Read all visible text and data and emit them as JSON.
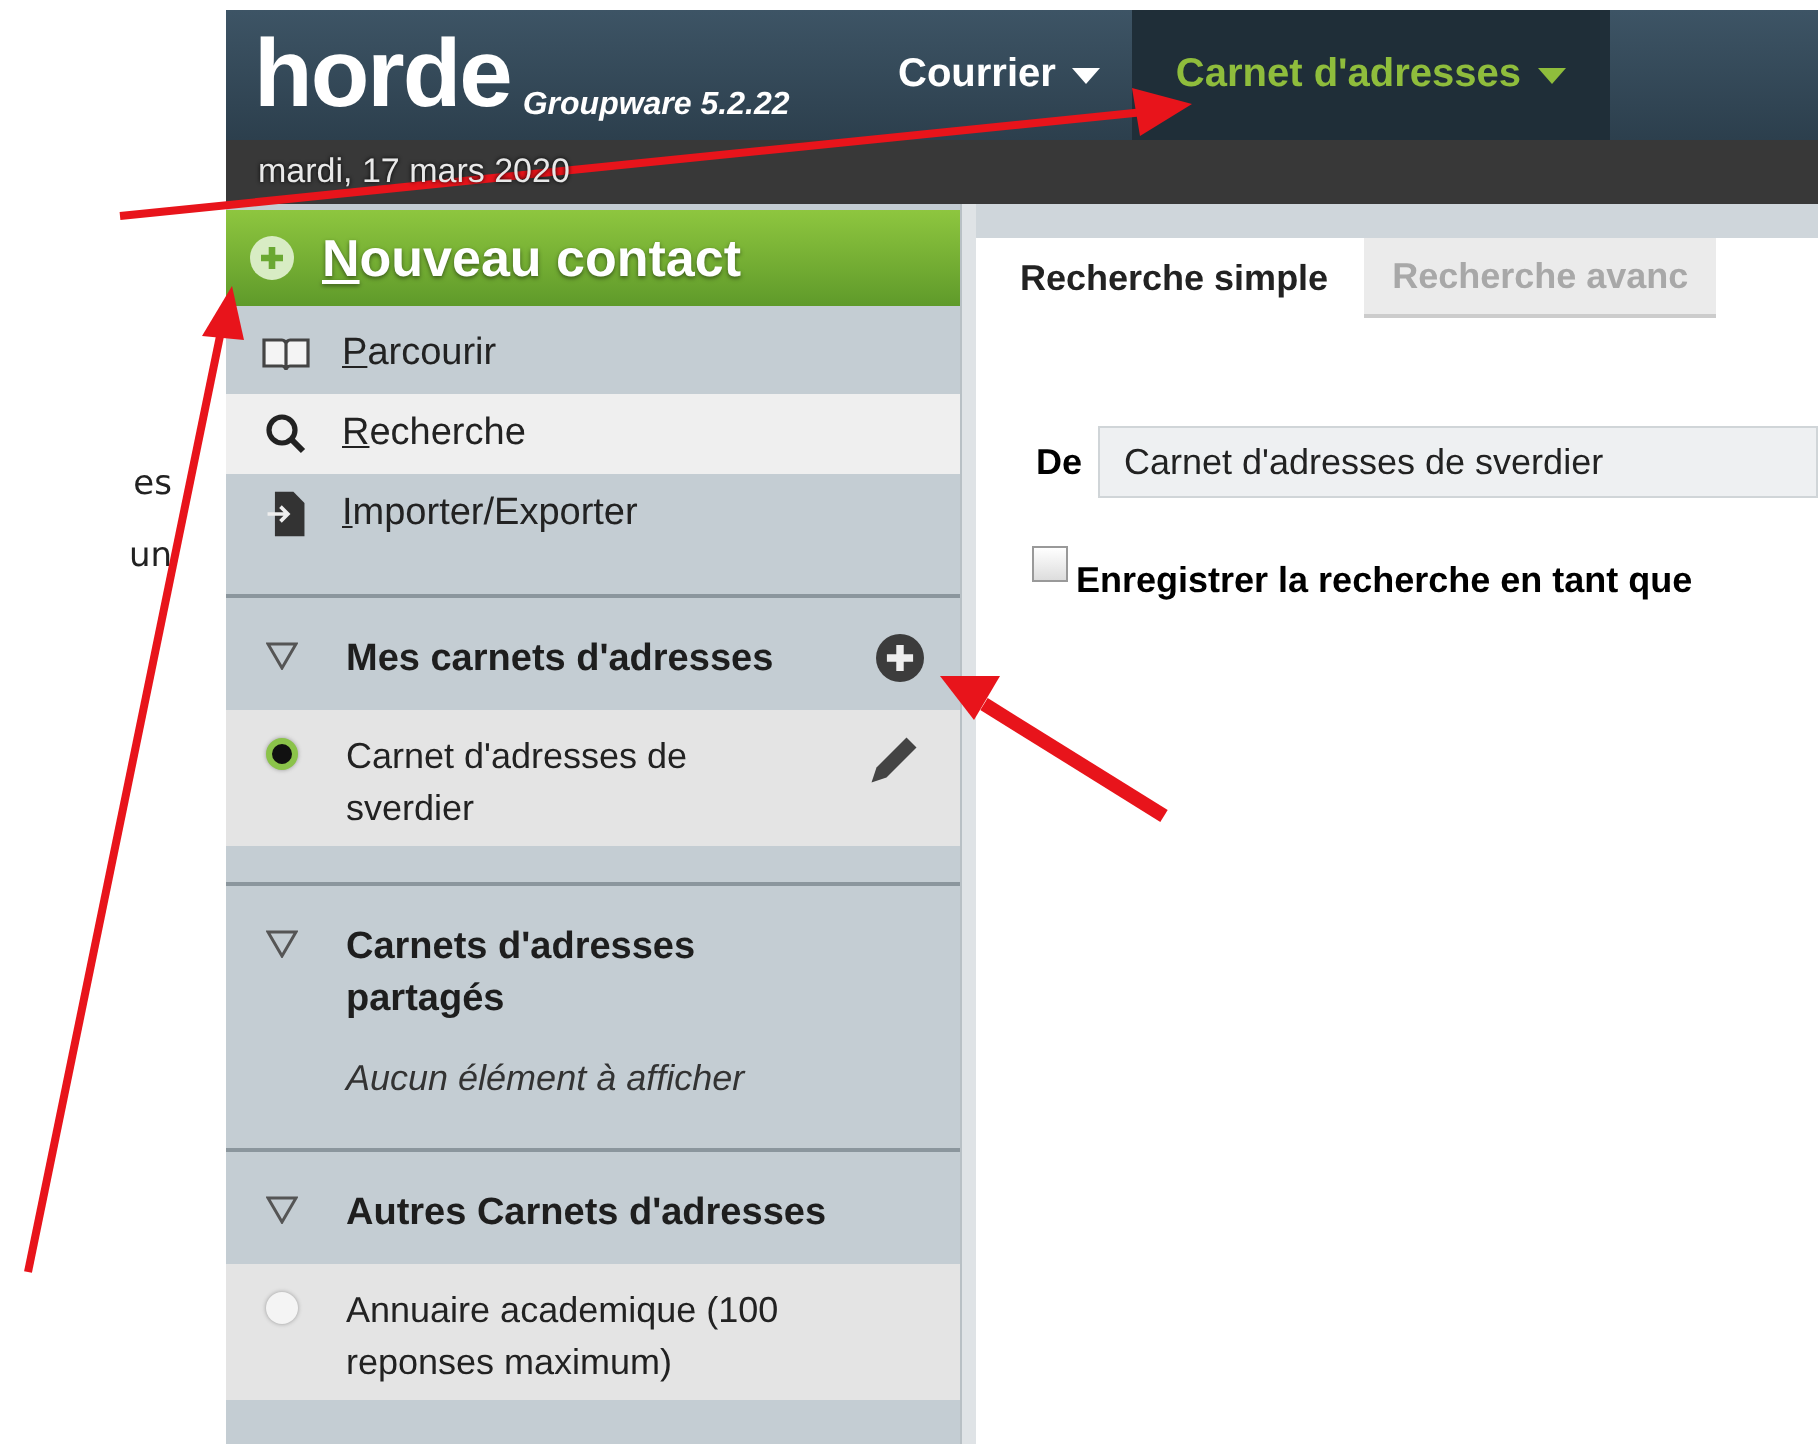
{
  "margin_text": [
    "es",
    "un"
  ],
  "header": {
    "logo": "horde",
    "product": "Groupware 5.2.22",
    "nav": [
      {
        "label": "Courrier",
        "selected": false
      },
      {
        "label": "Carnet d'adresses",
        "selected": true
      }
    ]
  },
  "date": "mardi, 17 mars 2020",
  "sidebar": {
    "new_contact": "Nouveau contact",
    "items": [
      {
        "label": "Parcourir",
        "kind": "browse",
        "selected": false
      },
      {
        "label": "Recherche",
        "kind": "search",
        "selected": true
      },
      {
        "label": "Importer/Exporter",
        "kind": "import",
        "selected": false
      }
    ],
    "sections": [
      {
        "title": "Mes carnets d'adresses",
        "expanded": true,
        "addable": true,
        "books": [
          {
            "name": "Carnet d'adresses de sverdier",
            "selected": true,
            "editable": true
          }
        ]
      },
      {
        "title": "Carnets d'adresses partagés",
        "expanded": true,
        "addable": false,
        "empty_text": "Aucun élément à afficher"
      },
      {
        "title": "Autres Carnets d'adresses",
        "expanded": true,
        "addable": false,
        "books": [
          {
            "name": "Annuaire academique (100 reponses maximum)",
            "selected": false,
            "editable": false
          }
        ]
      }
    ]
  },
  "main": {
    "tabs": [
      {
        "label": "Recherche simple",
        "selected": true
      },
      {
        "label": "Recherche avanc",
        "selected": false
      }
    ],
    "source": {
      "label": "De",
      "value": "Carnet d'adresses de sverdier"
    },
    "save_search": {
      "label": "Enregistrer la recherche en tant que",
      "checked": false
    }
  }
}
